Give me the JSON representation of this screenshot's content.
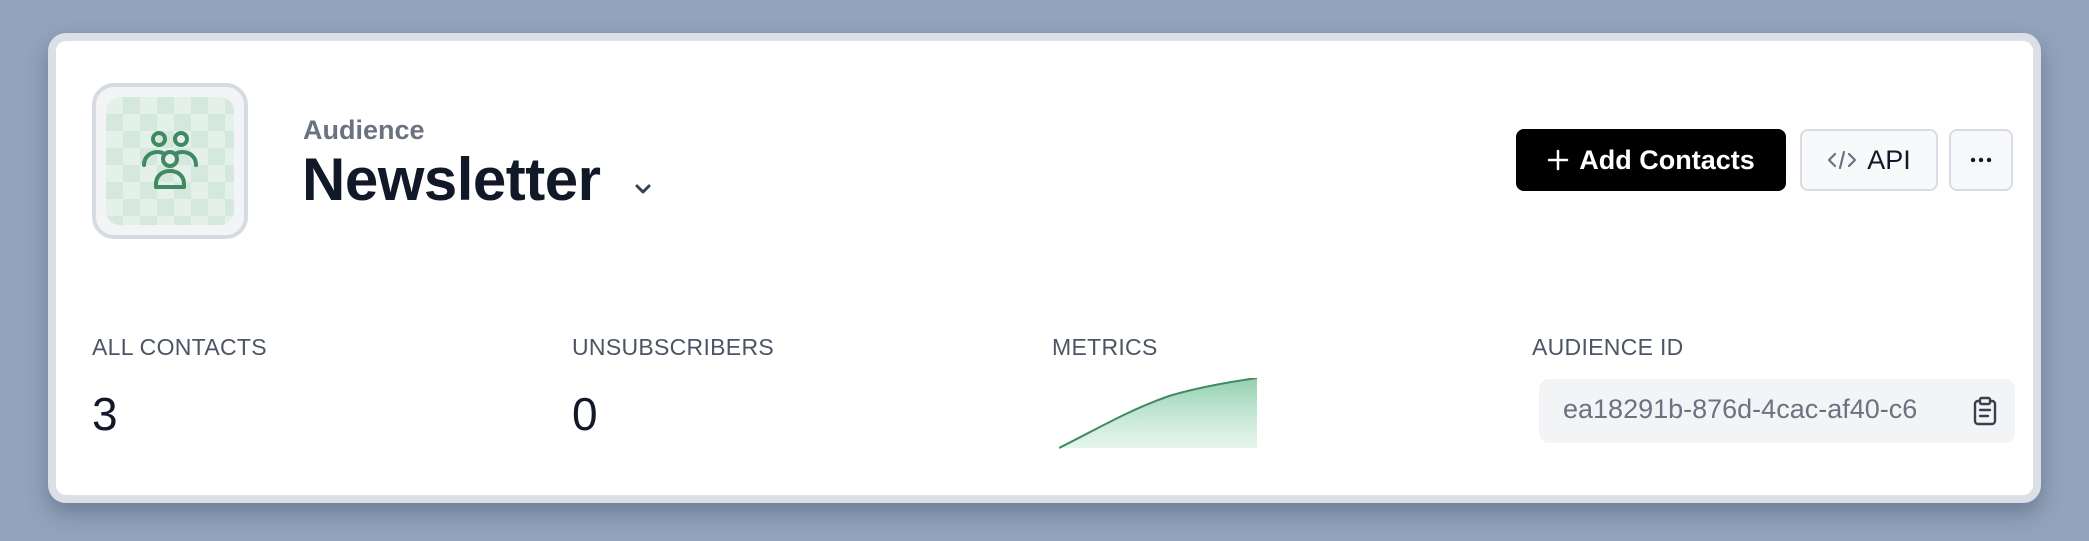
{
  "header": {
    "subtitle": "Audience",
    "title": "Newsletter"
  },
  "actions": {
    "add_contacts_label": "Add Contacts",
    "api_label": "API",
    "more_label": "···"
  },
  "stats": {
    "all_contacts": {
      "label": "ALL CONTACTS",
      "value": "3"
    },
    "unsubscribers": {
      "label": "UNSUBSCRIBERS",
      "value": "0"
    },
    "metrics": {
      "label": "METRICS"
    },
    "audience_id": {
      "label": "AUDIENCE ID",
      "value": "ea18291b-876d-4cac-af40-c6"
    }
  },
  "icons": {
    "logo": "users-group-icon",
    "dropdown": "chevron-down-icon",
    "add": "plus-icon",
    "api": "code-icon",
    "copy": "clipboard-icon"
  },
  "colors": {
    "accent_green": "#3f8a62",
    "primary_button": "#000000"
  }
}
